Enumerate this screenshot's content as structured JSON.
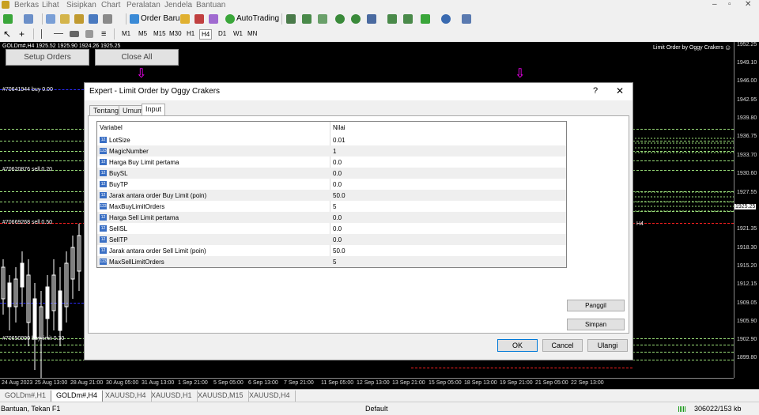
{
  "menu": [
    "Berkas",
    "Lihat",
    "Sisipkan",
    "Chart",
    "Peralatan",
    "Jendela",
    "Bantuan"
  ],
  "toolbar": {
    "order_baru": "Order Baru",
    "autotrading": "AutoTrading"
  },
  "timeframes": [
    "M1",
    "M5",
    "M15",
    "M30",
    "H1",
    "H4",
    "D1",
    "W1",
    "MN"
  ],
  "chart": {
    "info": "GOLDm#,H4  1925.52 1925.90 1924.26 1925.25",
    "ea_label": "Limit Order by Oggy Crakers",
    "setup_button": "Setup Orders",
    "close_button": "Close All",
    "h4_marker": "H4",
    "order_labels": [
      "#70641944 buy 0.00",
      "#70620876 sell 0.20",
      "#70669268 sell 0.50",
      "#70650990 buy limit 0.30"
    ],
    "prices": [
      "1952.25",
      "1949.10",
      "1946.00",
      "1942.95",
      "1939.80",
      "1936.75",
      "1933.70",
      "1930.60",
      "1927.55",
      "1925.25",
      "1921.35",
      "1918.30",
      "1915.20",
      "1912.15",
      "1909.05",
      "1905.90",
      "1902.90",
      "1899.80"
    ],
    "times": [
      "24 Aug 2023",
      "25 Aug 13:00",
      "28 Aug 21:00",
      "30 Aug 05:00",
      "31 Aug 13:00",
      "1 Sep 21:00",
      "5 Sep 05:00",
      "6 Sep 13:00",
      "7 Sep 21:00",
      "11 Sep 05:00",
      "12 Sep 13:00",
      "13 Sep 21:00",
      "15 Sep 05:00",
      "18 Sep 13:00",
      "19 Sep 21:00",
      "21 Sep 05:00",
      "22 Sep 13:00"
    ]
  },
  "dialog": {
    "title": "Expert - Limit Order by Oggy Crakers",
    "help": "?",
    "close": "✕",
    "tabs": [
      "Tentang",
      "Umum",
      "Input"
    ],
    "col_variable": "Variabel",
    "col_value": "Nilai",
    "params": [
      {
        "icon": "12",
        "name": "LotSize",
        "value": "0.01"
      },
      {
        "icon": "123",
        "name": "MagicNumber",
        "value": "1"
      },
      {
        "icon": "12",
        "name": "Harga Buy Limit pertama",
        "value": "0.0"
      },
      {
        "icon": "12",
        "name": "BuySL",
        "value": "0.0"
      },
      {
        "icon": "12",
        "name": "BuyTP",
        "value": "0.0"
      },
      {
        "icon": "12",
        "name": "Jarak antara order Buy Limit (poin)",
        "value": "50.0"
      },
      {
        "icon": "123",
        "name": "MaxBuyLimitOrders",
        "value": "5"
      },
      {
        "icon": "12",
        "name": "Harga Sell Limit pertama",
        "value": "0.0"
      },
      {
        "icon": "12",
        "name": "SellSL",
        "value": "0.0"
      },
      {
        "icon": "12",
        "name": "SellTP",
        "value": "0.0"
      },
      {
        "icon": "12",
        "name": "Jarak antara order Sell Limit (poin)",
        "value": "50.0"
      },
      {
        "icon": "123",
        "name": "MaxSellLimitOrders",
        "value": "5"
      }
    ],
    "load_button": "Panggil",
    "save_button": "Simpan",
    "ok_button": "OK",
    "cancel_button": "Cancel",
    "reset_button": "Ulangi"
  },
  "symbol_tabs": [
    "GOLDm#,H1",
    "GOLDm#,H4",
    "XAUUSD,H4",
    "XAUUSD,H1",
    "XAUUSD,M15",
    "XAUUSD,H4"
  ],
  "status": {
    "help": "Bantuan, Tekan F1",
    "profile": "Default",
    "traffic": "306022/153 kb"
  },
  "colors": {
    "accent": "#0078d7",
    "buy_line": "#2b2bff",
    "sell_line": "#ff2020",
    "level_line": "#9be07a",
    "arrow": "#ff00ff"
  }
}
